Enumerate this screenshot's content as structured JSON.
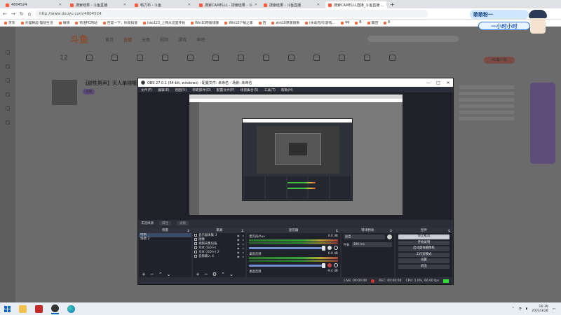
{
  "browser": {
    "tabs": [
      {
        "label": "4804524"
      },
      {
        "label": "搜索结果 - 斗鱼直播"
      },
      {
        "label": "鸭力布 - 斗鱼"
      },
      {
        "label": "搜索CAMELLL - 搜索结果 - 斗"
      },
      {
        "label": "搜索结果 - 斗鱼直播"
      },
      {
        "label": "搜索CAMELLL直播_斗鱼直播 ..."
      }
    ],
    "new_tab": "+",
    "url": "http://www.douyu.com/4804524",
    "bookmarks": [
      "京东",
      "天猫精选-理想生活",
      "微博",
      "有道PC网站",
      "百度一下，你就知道",
      "hao123_上网从这里开始",
      "Win10原版镜像",
      "Win10下载之家",
      "百",
      "win10原版镜像",
      "(永劫无间)游戏...",
      "qq",
      "B",
      "美团",
      "8"
    ]
  },
  "site": {
    "logo": "斗鱼",
    "nav": [
      "首页",
      "直播",
      "分类",
      "视频",
      "游戏",
      "鱼吧"
    ],
    "nav_selected_index": 1,
    "icons": [
      "12",
      "",
      "",
      "",
      "",
      "",
      "",
      "",
      "",
      "",
      "",
      "",
      "",
      ""
    ],
    "pc_button": "PC客户端",
    "stream_title": "【甜性男声】天人单排哦",
    "anchor_tag": "主播"
  },
  "badge": {
    "name": "歌歌粉一",
    "time": "一小时小时"
  },
  "obs": {
    "title": "OBS 27.0.1 (64-bit, windows) - 配置文件: 未命名 - 场景: 未命名",
    "menu": [
      "文件(F)",
      "编辑(E)",
      "视图(V)",
      "停靠部件(D)",
      "配置文件(P)",
      "场景集合(S)",
      "工具(T)",
      "帮助(H)"
    ],
    "scene_info": {
      "label": "未选择源",
      "props": "属性",
      "filters": "滤镜"
    },
    "docks": {
      "scenes": {
        "header": "场景",
        "items": [
          "场景",
          "场景 2"
        ],
        "selected_index": 0
      },
      "sources": {
        "header": "来源",
        "items": [
          "显示器采集 3",
          "图像",
          "视频采集设备",
          "文本 (GDI+)",
          "文本 (GDI+) 2",
          "音频输入 4"
        ]
      },
      "mixer": {
        "header": "混音器",
        "channels": [
          {
            "name": "麦克风/Aux",
            "db": "0.0 dB",
            "muted": false
          },
          {
            "name": "桌面音频",
            "db": "0.0 dB",
            "muted": true
          },
          {
            "name": "桌面音频",
            "db": "-9.4 dB",
            "muted": false
          }
        ]
      },
      "transitions": {
        "header": "转场特效",
        "mode": "淡出",
        "duration_label": "时长",
        "duration": "300 ms"
      },
      "controls": {
        "header": "控件",
        "buttons": [
          "停止推流",
          "开始录制",
          "启动虚拟摄像机",
          "工作室模式",
          "设置",
          "退出"
        ],
        "active_index": 0
      }
    },
    "status": {
      "live": "LIVE: 00:00:00",
      "rec": "REC: 00:00:00",
      "cpu": "CPU: 1.0%, 60.00 fps"
    }
  },
  "taskbar": {
    "time": "16:39",
    "date": "2022/3/28"
  }
}
